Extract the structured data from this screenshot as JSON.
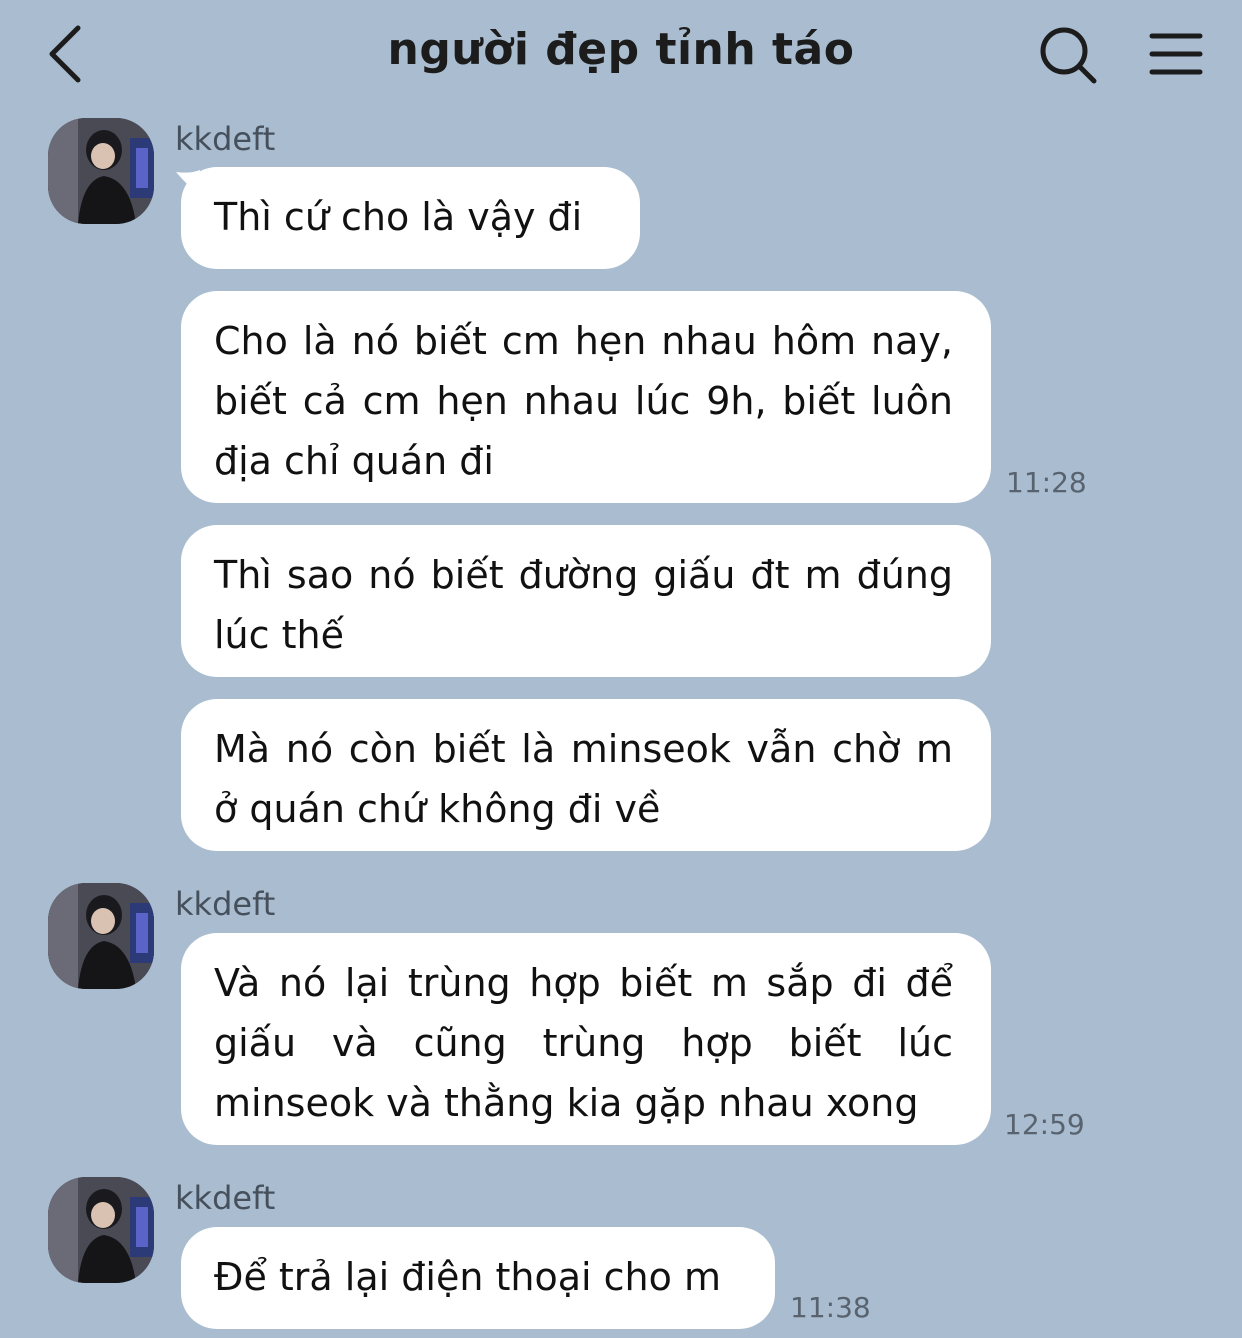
{
  "header": {
    "title": "người đẹp tỉnh táo"
  },
  "messages": [
    {
      "sender": "kkdeft",
      "bubbles": [
        {
          "text": "Thì cứ cho là vậy đi"
        },
        {
          "text": "Cho là nó biết cm hẹn nhau hôm nay, biết cả cm hẹn nhau lúc 9h, biết luôn địa chỉ quán đi",
          "time": "11:28"
        },
        {
          "text": "Thì sao nó biết đường giấu đt m đúng lúc thế"
        },
        {
          "text": "Mà nó còn biết là minseok vẫn chờ m ở quán chứ không đi về"
        }
      ]
    },
    {
      "sender": "kkdeft",
      "bubbles": [
        {
          "text": "Và nó lại trùng hợp biết m sắp đi để giấu và cũng trùng hợp biết lúc minseok và thằng kia gặp nhau xong",
          "time": "12:59"
        }
      ]
    },
    {
      "sender": "kkdeft",
      "bubbles": [
        {
          "text": "Để trả lại điện thoại cho m",
          "time": "11:38"
        }
      ]
    }
  ],
  "icons": {
    "back": "chevron-left-icon",
    "search": "search-icon",
    "menu": "hamburger-menu-icon",
    "avatar": "user-avatar"
  },
  "colors": {
    "background": "#aabdd0",
    "bubble": "#ffffff",
    "text": "#111111",
    "meta": "#58636f"
  }
}
